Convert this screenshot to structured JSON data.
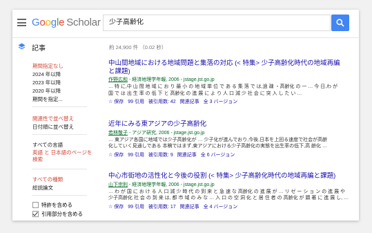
{
  "header": {
    "logo_google": "Google",
    "logo_scholar": "Scholar",
    "search_value": "少子高齢化"
  },
  "section": {
    "label": "記事",
    "result_count": "約 24,900 件 （0.02 秒）"
  },
  "sidebar": {
    "time_filters": [
      "期間指定なし",
      "2024 年以降",
      "2023 年以降",
      "2020 年以降",
      "期間を指定..."
    ],
    "sort": [
      "関連性で並べ替え",
      "日付順に並べ替え"
    ],
    "language": [
      "すべての言語",
      "英語 と 日本語のページを検索"
    ],
    "type": [
      "すべての種類",
      "総説論文"
    ],
    "checkboxes": [
      {
        "label": "特許を含める",
        "checked": false
      },
      {
        "label": "引用部分を含める",
        "checked": true
      }
    ]
  },
  "results": [
    {
      "title_line1": "中山間地域における地域問題と集落の対応 (< 特集> 少子高齢化時代の地域再編",
      "title_line2": "と課題)",
      "author": "作野広和",
      "source": " - 経済地理学年報, 2006 - jstage.jst.go.jp",
      "snippet1": "… 特 に,中 山 間 地 域 に お り 最 小 の 地 域 単 位 で あ る 集 落 で は,過 疎 ・高齢化 の 一 … 今 日,わ が",
      "snippet2": "国 で は 出 生 率 の 低 下 と 高齢化 の 進 展 に よ り 人 口 減 少 社 会 に 突 入 し た い …",
      "save": "☆ 保存",
      "cite": "99 引用",
      "cited_by": "被引用数: 42",
      "related": "関連記事",
      "versions": "全 3 バージョン"
    },
    {
      "title_line1": "近年にみる東アジアの少子高齢化",
      "title_line2": "",
      "author": "若林敬子",
      "source": " - アジア研究, 2006 - jstage.jst.go.jp",
      "snippet1": "… 東アジア各国に地域では少子高齢化が … 少子化が進んでおり,今後,日本を上回る速度で社会が高齢",
      "snippet2": "化していく見通しである 本稿ではまず,東アジアにおける少子高齢化の実態を出生率の低下,高 齢化 …",
      "save": "☆ 保存",
      "cite": "99 引用",
      "cited_by": "被引用数: 9",
      "related": "関連記事",
      "versions": "全 6 バージョン"
    },
    {
      "title_line1": "中心市街地の活性化と今後の役割 (< 特集> 少子高齢化時代の地域再編と課題)",
      "title_line2": "",
      "author": "山下宗利",
      "source": " - 経済地理学年報, 2006 - jstage.jst.go.jp",
      "snippet1": "… わ が 国 に お け る 人 口 減 少 時 代 の 到 来 と 急 速 な 高齢化 の 進 展 が … リ ゼ ー シ ョ ン の 進 展 や",
      "snippet2": "少子高齢化 社 会 の 到 来 は, 都 市 域 の み な … 入 口 の 空 洞 化 と 居 住 者 の 高齢化 が 顕 著 に 進 展 し, …",
      "save": "☆ 保存",
      "cite": "99 引用",
      "cited_by": "被引用数: 17",
      "related": "関連記事",
      "versions": "全 4 バージョン"
    }
  ]
}
